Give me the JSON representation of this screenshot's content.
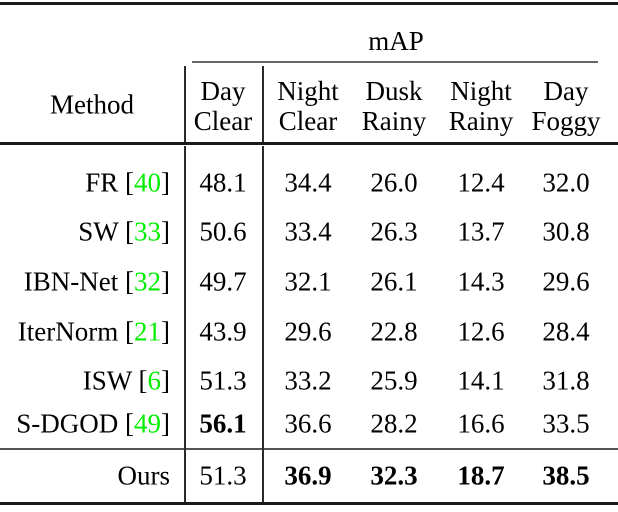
{
  "table": {
    "caption_group_header": "mAP",
    "method_column_header": "Method",
    "columns": [
      {
        "id": "day-clear",
        "line1": "Day",
        "line2": "Clear"
      },
      {
        "id": "night-clear",
        "line1": "Night",
        "line2": "Clear"
      },
      {
        "id": "dusk-rainy",
        "line1": "Dusk",
        "line2": "Rainy"
      },
      {
        "id": "night-rainy",
        "line1": "Night",
        "line2": "Rainy"
      },
      {
        "id": "day-foggy",
        "line1": "Day",
        "line2": "Foggy"
      }
    ],
    "rows": [
      {
        "method_name": "FR",
        "citation_open": "[",
        "citation_number": "40",
        "citation_close": "]",
        "values": [
          "48.1",
          "34.4",
          "26.0",
          "12.4",
          "32.0"
        ],
        "bold_flags": [
          false,
          false,
          false,
          false,
          false
        ]
      },
      {
        "method_name": "SW",
        "citation_open": "[",
        "citation_number": "33",
        "citation_close": "]",
        "values": [
          "50.6",
          "33.4",
          "26.3",
          "13.7",
          "30.8"
        ],
        "bold_flags": [
          false,
          false,
          false,
          false,
          false
        ]
      },
      {
        "method_name": "IBN-Net",
        "citation_open": "[",
        "citation_number": "32",
        "citation_close": "]",
        "values": [
          "49.7",
          "32.1",
          "26.1",
          "14.3",
          "29.6"
        ],
        "bold_flags": [
          false,
          false,
          false,
          false,
          false
        ]
      },
      {
        "method_name": "IterNorm",
        "citation_open": "[",
        "citation_number": "21",
        "citation_close": "]",
        "values": [
          "43.9",
          "29.6",
          "22.8",
          "12.6",
          "28.4"
        ],
        "bold_flags": [
          false,
          false,
          false,
          false,
          false
        ]
      },
      {
        "method_name": "ISW",
        "citation_open": "[",
        "citation_number": "6",
        "citation_close": "]",
        "values": [
          "51.3",
          "33.2",
          "25.9",
          "14.1",
          "31.8"
        ],
        "bold_flags": [
          false,
          false,
          false,
          false,
          false
        ]
      },
      {
        "method_name": "S-DGOD",
        "citation_open": "[",
        "citation_number": "49",
        "citation_close": "]",
        "values": [
          "56.1",
          "36.6",
          "28.2",
          "16.6",
          "33.5"
        ],
        "bold_flags": [
          true,
          false,
          false,
          false,
          false
        ]
      },
      {
        "method_name": "Ours",
        "citation_open": "",
        "citation_number": "",
        "citation_close": "",
        "values": [
          "51.3",
          "36.9",
          "32.3",
          "18.7",
          "38.5"
        ],
        "bold_flags": [
          false,
          true,
          true,
          true,
          true
        ]
      }
    ]
  },
  "colors": {
    "citation_green": "#00ee00",
    "rule_black": "#1a1a1a",
    "text_black": "#000000"
  },
  "chart_data": {
    "type": "table",
    "title": "mAP",
    "row_header_label": "Method",
    "categories": [
      "Day Clear",
      "Night Clear",
      "Dusk Rainy",
      "Night Rainy",
      "Day Foggy"
    ],
    "series": [
      {
        "name": "FR [40]",
        "values": [
          48.1,
          34.4,
          26.0,
          12.4,
          32.0
        ]
      },
      {
        "name": "SW [33]",
        "values": [
          50.6,
          33.4,
          26.3,
          13.7,
          30.8
        ]
      },
      {
        "name": "IBN-Net [32]",
        "values": [
          49.7,
          32.1,
          26.1,
          14.3,
          29.6
        ]
      },
      {
        "name": "IterNorm [21]",
        "values": [
          43.9,
          29.6,
          22.8,
          12.6,
          28.4
        ]
      },
      {
        "name": "ISW [6]",
        "values": [
          51.3,
          33.2,
          25.9,
          14.1,
          31.8
        ]
      },
      {
        "name": "S-DGOD [49]",
        "values": [
          56.1,
          36.6,
          28.2,
          16.6,
          33.5
        ]
      },
      {
        "name": "Ours",
        "values": [
          51.3,
          36.9,
          32.3,
          18.7,
          38.5
        ]
      }
    ],
    "highlighted_best": {
      "Day Clear": "S-DGOD [49] 56.1",
      "Night Clear": "Ours 36.9",
      "Dusk Rainy": "Ours 32.3",
      "Night Rainy": "Ours 18.7",
      "Day Foggy": "Ours 38.5"
    },
    "xlabel": "",
    "ylabel": "mAP",
    "grid": false,
    "legend": "none"
  }
}
